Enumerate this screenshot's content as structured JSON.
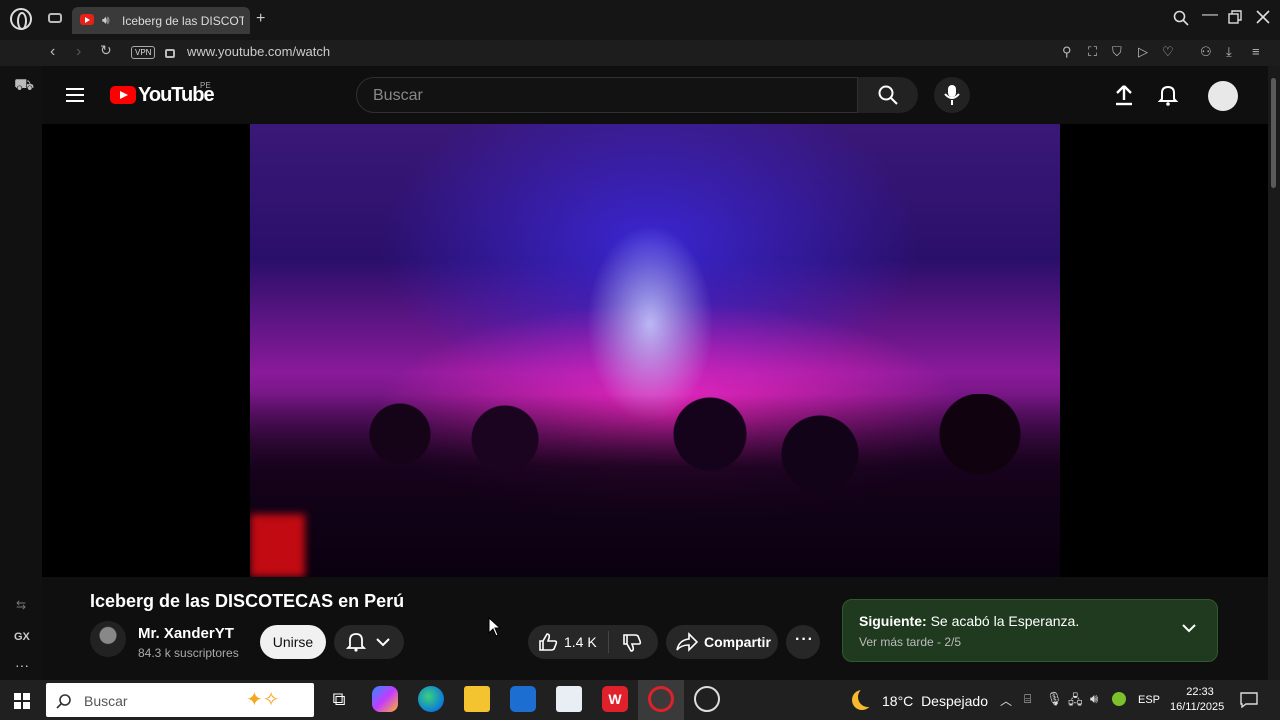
{
  "browser": {
    "tab_title": "Iceberg de las DISCOTECAS en Perú",
    "url": "www.youtube.com/watch",
    "vpn_label": "VPN",
    "sidebar_gx": "GX"
  },
  "youtube": {
    "logo_text": "YouTube",
    "region": "PE",
    "search_placeholder": "Buscar"
  },
  "video": {
    "title": "Iceberg de las DISCOTECAS en Perú",
    "channel_name": "Mr. XanderYT",
    "subscribers": "84.3 k suscriptores",
    "join_label": "Unirse",
    "likes": "1.4 K",
    "share_label": "Compartir"
  },
  "playlist": {
    "next_prefix": "Siguiente:",
    "next_title": "Se acabó la Esperanza.",
    "subtitle": "Ver más tarde - 2/5",
    "accent": "#1f3a1f"
  },
  "taskbar": {
    "search_placeholder": "Buscar",
    "temperature": "18°C",
    "weather": "Despejado",
    "language": "ESP",
    "time": "22:33",
    "date": "16/11/2025"
  }
}
